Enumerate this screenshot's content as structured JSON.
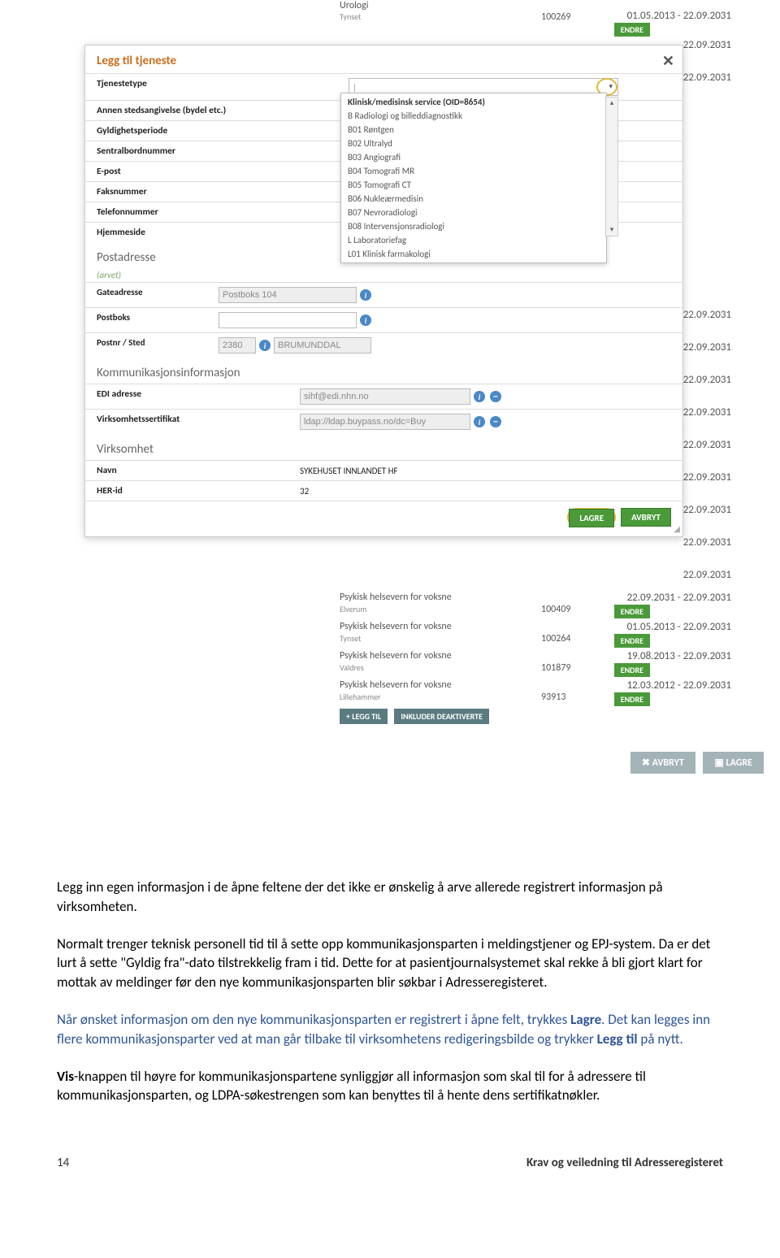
{
  "bg": {
    "urologi": "Urologi",
    "tynset": "Tynset",
    "elverum": "Elverum",
    "valdres": "Valdres",
    "lillehammer": "Lillehammer",
    "endre": "ENDRE",
    "legg_til": "+ LEGG TIL",
    "inkluder": "INKLUDER DEAKTIVERTE",
    "avbryt": "AVBRYT",
    "lagre": "LAGRE",
    "items": [
      {
        "name": "Psykisk helsevern for voksne",
        "num": "100409",
        "dates": "22.09.2031 - 22.09.2031"
      },
      {
        "name": "Psykisk helsevern for voksne",
        "num": "100264",
        "dates": "01.05.2013 - 22.09.2031"
      },
      {
        "name": "Psykisk helsevern for voksne",
        "num": "101879",
        "dates": "19.08.2013 - 22.09.2031"
      },
      {
        "name": "Psykisk helsevern for voksne",
        "num": "93913",
        "dates": "12.03.2012 - 22.09.2031"
      }
    ],
    "right_dates": [
      "22.09.2031",
      "22.09.2031",
      "22.09.2031",
      "22.09.2031",
      "22.09.2031",
      "22.09.2031",
      "22.09.2031",
      "22.09.2031",
      "22.09.2031"
    ],
    "top_num": "100269",
    "top_dates": "01.05.2013 - 22.09.2031"
  },
  "modal": {
    "title": "Legg til tjeneste",
    "fields": {
      "tjenestetype": "Tjenestetype",
      "annen": "Annen stedsangivelse (bydel etc.)",
      "gyldig": "Gyldighetsperiode",
      "sentral": "Sentralbordnummer",
      "epost": "E-post",
      "faks": "Faksnummer",
      "telefon": "Telefonnummer",
      "hjemmeside": "Hjemmeside"
    },
    "post": {
      "title": "Postadresse",
      "arvet": "(arvet)",
      "gate_l": "Gateadresse",
      "gate_v": "Postboks 104",
      "postboks_l": "Postboks",
      "postnr_l": "Postnr / Sted",
      "postnr_v": "2380",
      "sted_v": "BRUMUNDDAL"
    },
    "komm": {
      "title": "Kommunikasjonsinformasjon",
      "edi_l": "EDI adresse",
      "edi_v": "sihf@edi.nhn.no",
      "sert_l": "Virksomhetssertifikat",
      "sert_v": "ldap://ldap.buypass.no/dc=Buy"
    },
    "virk": {
      "title": "Virksomhet",
      "navn_l": "Navn",
      "navn_v": "SYKEHUSET INNLANDET HF",
      "her_l": "HER-id",
      "her_v": "32"
    },
    "dropdown": {
      "header": "Klinisk/medisinsk service (OID=8654)",
      "items": [
        "B Radiologi og billeddiagnostikk",
        "B01 Røntgen",
        "B02 Ultralyd",
        "B03 Angiografi",
        "B04 Tomografi MR",
        "B05 Tomografi CT",
        "B06 Nukleærmedisin",
        "B07 Nevroradiologi",
        "B08 Intervensjonsradiologi",
        "L Laboratoriefag",
        "L01 Klinisk farmakologi"
      ]
    },
    "lagre": "LAGRE",
    "avbryt": "AVBRYT"
  },
  "text": {
    "p1": "Legg inn egen informasjon i de åpne feltene der det ikke er ønskelig å arve allerede registrert informasjon på virksomheten.",
    "p2a": "Normalt trenger teknisk personell tid til å sette opp kommunikasjonsparten i meldingstjener og EPJ-system. Da er det lurt å sette \"Gyldig fra\"-dato tilstrekkelig fram i tid. Dette for at pasientjournalsystemet skal rekke å bli gjort klart for mottak av meldinger før den nye kommunikasjonsparten blir søkbar i Adresseregisteret.",
    "p3a": "Når ønsket informasjon om den nye kommunikasjonsparten er registrert i åpne felt, trykkes ",
    "p3b": "Lagre",
    "p3c": ". Det kan legges inn flere kommunikasjonsparter ved at man går tilbake til virksomhetens redigeringsbilde og trykker ",
    "p3d": "Legg til",
    "p3e": " på nytt.",
    "p4a": "Vis",
    "p4b": "-knappen til høyre for kommunikasjonspartene synliggjør all informasjon som skal til for å adressere til kommunikasjonsparten, og LDPA-søkestrengen som kan benyttes til å hente dens sertifikatnøkler."
  },
  "footer": {
    "page": "14",
    "doc": "Krav og veiledning til Adresseregisteret"
  }
}
